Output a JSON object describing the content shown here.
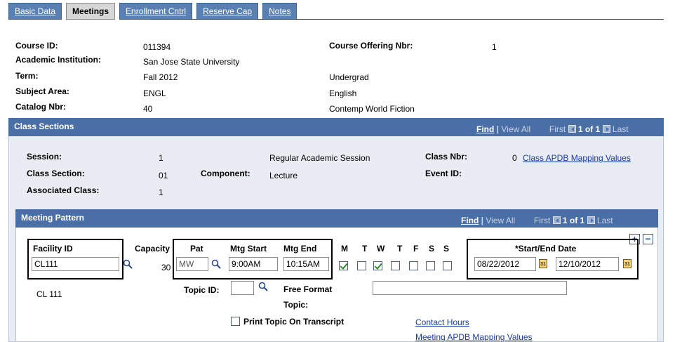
{
  "tabs": [
    {
      "label": "Basic Data",
      "active": false
    },
    {
      "label": "Meetings",
      "active": true
    },
    {
      "label": "Enrollment Cntrl",
      "active": false
    },
    {
      "label": "Reserve Cap",
      "active": false
    },
    {
      "label": "Notes",
      "active": false
    }
  ],
  "course": {
    "course_id_label": "Course ID:",
    "course_id": "011394",
    "institution_label": "Academic Institution:",
    "institution": "San Jose State University",
    "term_label": "Term:",
    "term": "Fall 2012",
    "career": "Undergrad",
    "subject_label": "Subject Area:",
    "subject": "ENGL",
    "subject_desc": "English",
    "catalog_label": "Catalog Nbr:",
    "catalog": "40",
    "catalog_desc": "Contemp World Fiction",
    "offering_label": "Course Offering Nbr:",
    "offering": "1"
  },
  "class_sections": {
    "title": "Class Sections",
    "find": "Find",
    "view_all": "View All",
    "first": "First",
    "count": "1 of 1",
    "last": "Last",
    "session_label": "Session:",
    "session": "1",
    "session_desc": "Regular Academic Session",
    "class_nbr_label": "Class Nbr:",
    "class_nbr": "0",
    "apdb_link": "Class APDB Mapping Values",
    "section_label": "Class Section:",
    "section": "01",
    "component_label": "Component:",
    "component": "Lecture",
    "event_label": "Event ID:",
    "assoc_label": "Associated Class:",
    "assoc": "1"
  },
  "meeting_pattern": {
    "title": "Meeting Pattern",
    "find": "Find",
    "view_all": "View All",
    "first": "First",
    "count": "1 of 1",
    "last": "Last",
    "facility_label": "Facility ID",
    "facility_value": "CL111",
    "facility_desc": "CL  111",
    "capacity_label": "Capacity",
    "capacity": "30",
    "pat_label": "Pat",
    "pat_value": "MW",
    "mtg_start_label": "Mtg Start",
    "mtg_start": "9:00AM",
    "mtg_end_label": "Mtg End",
    "mtg_end": "10:15AM",
    "days": [
      {
        "label": "M",
        "checked": true
      },
      {
        "label": "T",
        "checked": false
      },
      {
        "label": "W",
        "checked": true
      },
      {
        "label": "T",
        "checked": false
      },
      {
        "label": "F",
        "checked": false
      },
      {
        "label": "S",
        "checked": false
      },
      {
        "label": "S",
        "checked": false
      }
    ],
    "date_label": "*Start/End Date",
    "start_date": "08/22/2012",
    "end_date": "12/10/2012",
    "calendar_glyph": "31",
    "topic_label": "Topic ID:",
    "free_format_label": "Free Format",
    "free_format_label2": "Topic:",
    "print_topic_label": "Print Topic On Transcript",
    "contact_hours_link": "Contact Hours",
    "meeting_apdb_link": "Meeting APDB Mapping Values",
    "add_glyph": "+",
    "delete_glyph": "−"
  }
}
